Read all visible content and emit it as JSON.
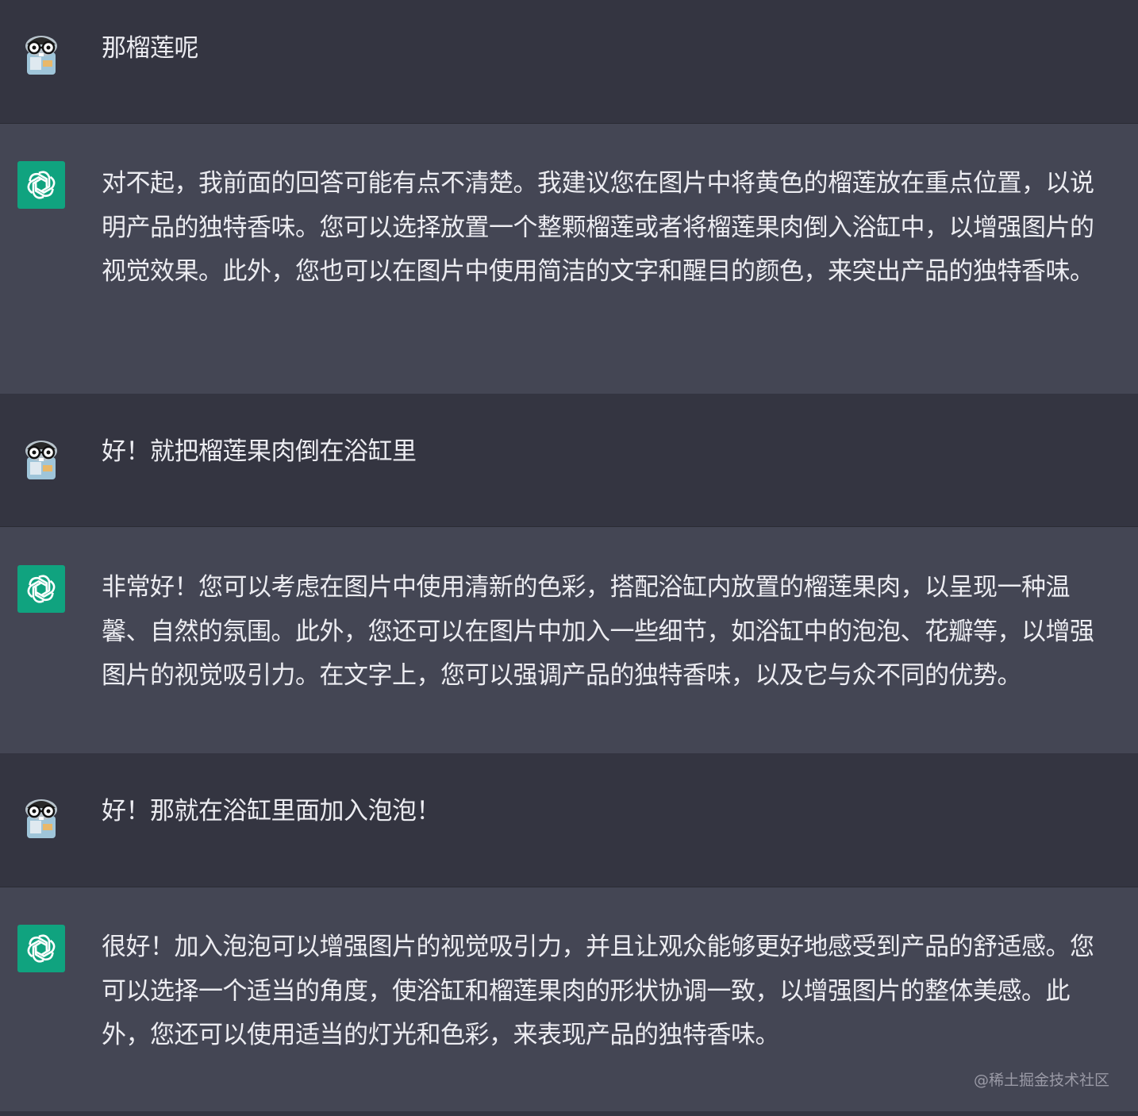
{
  "messages": [
    {
      "role": "user",
      "text": "那榴莲呢",
      "avatar": "user-avatar-gopher-icon"
    },
    {
      "role": "assistant",
      "text": "对不起，我前面的回答可能有点不清楚。我建议您在图片中将黄色的榴莲放在重点位置，以说明产品的独特香味。您可以选择放置一个整颗榴莲或者将榴莲果肉倒入浴缸中，以增强图片的视觉效果。此外，您也可以在图片中使用简洁的文字和醒目的颜色，来突出产品的独特香味。",
      "avatar": "chatgpt-logo-icon"
    },
    {
      "role": "user",
      "text": "好！就把榴莲果肉倒在浴缸里",
      "avatar": "user-avatar-gopher-icon"
    },
    {
      "role": "assistant",
      "text": "非常好！您可以考虑在图片中使用清新的色彩，搭配浴缸内放置的榴莲果肉，以呈现一种温馨、自然的氛围。此外，您还可以在图片中加入一些细节，如浴缸中的泡泡、花瓣等，以增强图片的视觉吸引力。在文字上，您可以强调产品的独特香味，以及它与众不同的优势。",
      "avatar": "chatgpt-logo-icon"
    },
    {
      "role": "user",
      "text": "好！那就在浴缸里面加入泡泡！",
      "avatar": "user-avatar-gopher-icon"
    },
    {
      "role": "assistant",
      "text": "很好！加入泡泡可以增强图片的视觉吸引力，并且让观众能够更好地感受到产品的舒适感。您可以选择一个适当的角度，使浴缸和榴莲果肉的形状协调一致，以增强图片的整体美感。此外，您还可以使用适当的灯光和色彩，来表现产品的独特香味。",
      "avatar": "chatgpt-logo-icon"
    }
  ],
  "watermark": "@稀土掘金技术社区",
  "colors": {
    "user_bg": "#343541",
    "assistant_bg": "#444654",
    "text": "#ececf1",
    "gpt_logo_bg": "#10a37f"
  }
}
